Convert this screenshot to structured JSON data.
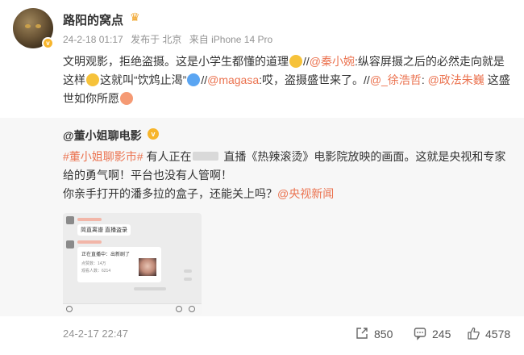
{
  "author": {
    "name": "路阳的窝点",
    "avatar_icon": "cat-avatar-icon",
    "badge_icon": "gold-verified-icon",
    "crown_icon": "crown-badge-icon"
  },
  "meta": {
    "datetime": "24-2-18 01:17",
    "location": "发布于 北京",
    "device": "来自 iPhone 14 Pro"
  },
  "post": {
    "t1": "文明观影，拒绝盗摄。这是小学生都懂的道理",
    "t2": "//",
    "m1": "@秦小婉",
    "t3": ":纵容屏摄之后的必然走向就是这样",
    "t4": "这就叫“饮鸩止渴”",
    "t5": "//",
    "m2": "@magasa",
    "t6": ":哎，盗摄盛世来了。//",
    "m3": "@_徐浩哲",
    "t7": ": ",
    "m4": "@政法朱巍",
    "t8": " 这盛世如你所愿"
  },
  "repost": {
    "author": "@董小姐聊电影",
    "v_icon": "gold-verified-icon",
    "tag": "#董小姐聊影市#",
    "r1": " 有人正在",
    "r2": " 直播《热辣滚烫》电影院放映的画面。这就是央视和专家给的勇气啊！平台也没有人管啊！",
    "r3": "你亲手打开的潘多拉的盒子，还能关上吗？",
    "mention": "@央视新闻",
    "thumbnail": {
      "bubble1": "简直离谱 直播盗录",
      "card_title": "正在直播中：出新剧了",
      "card_line1": "点赞数：14万",
      "card_line2": "观看人数：6214"
    }
  },
  "footer": {
    "time": "24-2-17 22:47",
    "reposts": "850",
    "comments": "245",
    "likes": "4578",
    "share_icon": "share-icon",
    "comment_icon": "comment-icon",
    "like_icon": "like-icon"
  }
}
